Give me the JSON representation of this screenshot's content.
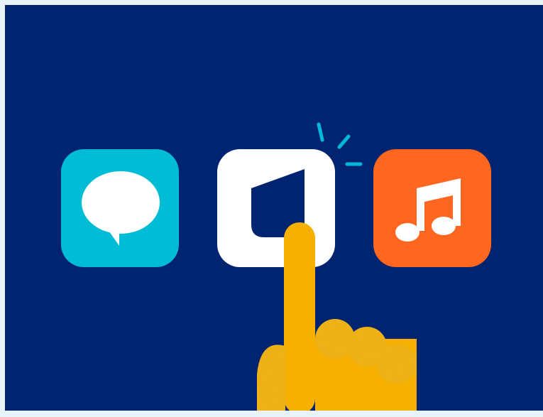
{
  "scene": {
    "description_name": "app-tap-illustration",
    "colors": {
      "page_border": "#e9f3fa",
      "background": "#012470",
      "chat_app_bg": "#00bcd4",
      "chat_bubble": "#ffffff",
      "selected_app_bg": "#ffffff",
      "selected_app_logo": "#012470",
      "music_app_bg": "#ff6620",
      "music_note": "#ffffff",
      "hand": "#f5b000",
      "hand_shadow": "#e39a00",
      "tap_sparks": "#00b8d9"
    },
    "apps": [
      {
        "id": "chat",
        "icon": "speech-bubble-icon",
        "selected": false
      },
      {
        "id": "shield",
        "icon": "shield-logo-icon",
        "selected": true
      },
      {
        "id": "music",
        "icon": "music-note-icon",
        "selected": false
      }
    ],
    "pointer": {
      "icon": "pointing-hand-icon",
      "target": "shield"
    }
  }
}
